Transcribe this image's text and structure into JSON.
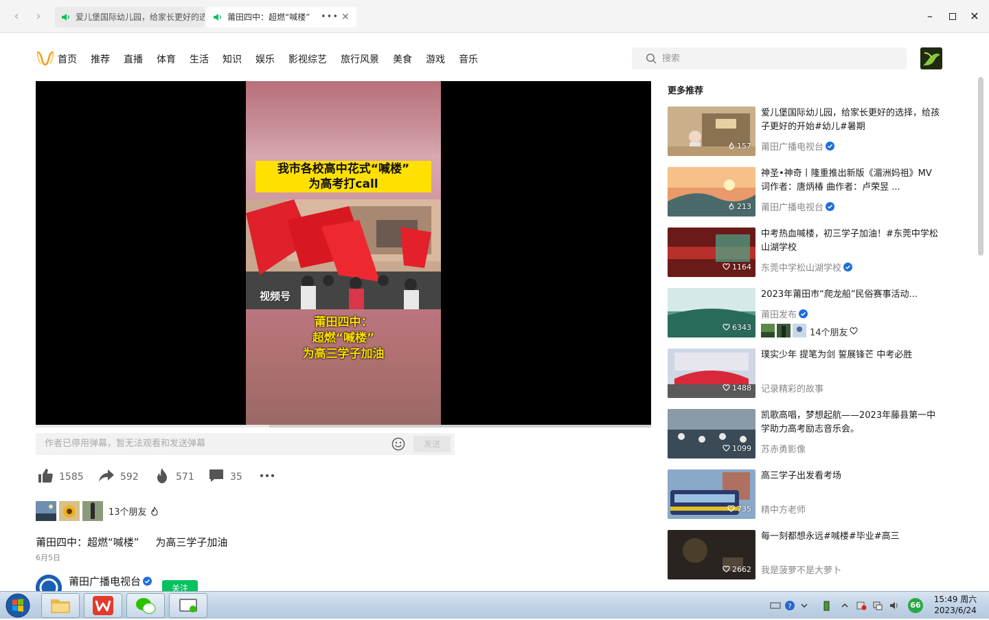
{
  "browser": {
    "tabs": [
      {
        "label": "爱儿堡国际幼儿园，给家长更好的选",
        "active": false
      },
      {
        "label": "莆田四中：超燃“喊楼”",
        "active": true
      }
    ],
    "more_glyph": "•••"
  },
  "header": {
    "nav": [
      "首页",
      "推荐",
      "直播",
      "体育",
      "生活",
      "知识",
      "娱乐",
      "影视综艺",
      "旅行风景",
      "美食",
      "游戏",
      "音乐"
    ],
    "search_placeholder": "搜索"
  },
  "video": {
    "caption_top_line1": "我市各校高中花式“喊楼”",
    "caption_top_line2": "为高考打call",
    "watermark": "视频号",
    "caption_bottom_line1": "莆田四中：",
    "caption_bottom_line2": "超燃“喊楼”",
    "caption_bottom_line3": "为高三学子加油",
    "progress_played": 0.38
  },
  "danmu": {
    "placeholder": "作者已停用弹幕，暂无法观看和发送弹幕",
    "send_label": "发送"
  },
  "actions": {
    "like": "1585",
    "share": "592",
    "fire": "571",
    "comment": "35"
  },
  "friends": {
    "text": "13个朋友"
  },
  "post": {
    "title": "莆田四中：超燃“喊楼”     为高三学子加油",
    "date": "6月5日",
    "author": "莆田广播电视台",
    "follow_label": "关注"
  },
  "sidebar": {
    "title": "更多推荐",
    "items": [
      {
        "title": "爱儿堡国际幼儿园，给家长更好的选择，给孩子更好的开始#幼儿#暑期",
        "author": "莆田广播电视台",
        "verified": true,
        "likes": "157",
        "like_icon": "fire"
      },
      {
        "title": "神圣•神奇丨隆重推出新版《湄洲妈祖》MV 词作者：唐炳椿  曲作者：卢荣昱 ...",
        "author": "莆田广播电视台",
        "verified": true,
        "likes": "213",
        "like_icon": "fire"
      },
      {
        "title": "中考热血喊楼，初三学子加油！#东莞中学松山湖学校",
        "author": "东莞中学松山湖学校",
        "verified": true,
        "likes": "1164",
        "like_icon": "heart"
      },
      {
        "title": "2023年莆田市“爬龙船”民俗赛事活动...",
        "author": "莆田发布",
        "verified": true,
        "likes": "6343",
        "like_icon": "heart",
        "friends_text": "14个朋友"
      },
      {
        "title": "璞实少年 提笔为剑 誓展锋芒 中考必胜",
        "author": "记录精彩的故事",
        "verified": false,
        "likes": "1488",
        "like_icon": "heart"
      },
      {
        "title": "凯歌高唱，梦想起航——2023年藤县第一中学助力高考励志音乐会。",
        "author": "苏赤勇影像",
        "verified": false,
        "likes": "1099",
        "like_icon": "heart"
      },
      {
        "title": "高三学子出发看考场",
        "author": "精中方老师",
        "verified": false,
        "likes": "735",
        "like_icon": "heart"
      },
      {
        "title": "每一刻都想永远#喊楼#毕业#高三",
        "author": "我是菠萝不是大萝卜",
        "verified": false,
        "likes": "2662",
        "like_icon": "heart"
      }
    ]
  },
  "taskbar": {
    "time": "15:49 周六",
    "date": "2023/6/24",
    "badge": "66"
  },
  "colors": {
    "accent_green": "#07c160",
    "caption_yellow": "#ffe000",
    "verified_blue": "#1e6fd9"
  }
}
